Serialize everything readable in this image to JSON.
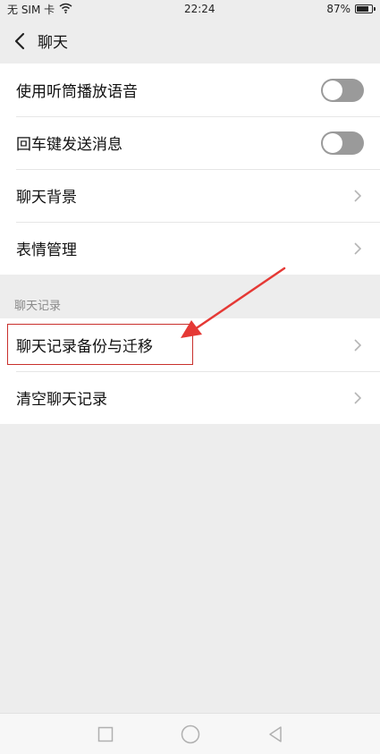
{
  "status_bar": {
    "carrier": "无 SIM 卡",
    "time": "22:24",
    "battery": "87%",
    "battery_level": 0.87
  },
  "nav": {
    "title": "聊天",
    "back_icon": "chevron-left-icon"
  },
  "settings": {
    "items": [
      {
        "label": "使用听筒播放语音",
        "control": "toggle",
        "on": false
      },
      {
        "label": "回车键发送消息",
        "control": "toggle",
        "on": false
      },
      {
        "label": "聊天背景",
        "control": "chevron"
      },
      {
        "label": "表情管理",
        "control": "chevron"
      }
    ]
  },
  "chat_history": {
    "section_label": "聊天记录",
    "items": [
      {
        "label": "聊天记录备份与迁移",
        "control": "chevron",
        "highlighted": true
      },
      {
        "label": "清空聊天记录",
        "control": "chevron"
      }
    ]
  },
  "annotation": {
    "color": "#e53935"
  },
  "colors": {
    "toggle_off": "#9a9a9a",
    "background": "#ededed"
  },
  "system_nav": {
    "icons": [
      "square-icon",
      "circle-icon",
      "triangle-back-icon"
    ]
  }
}
